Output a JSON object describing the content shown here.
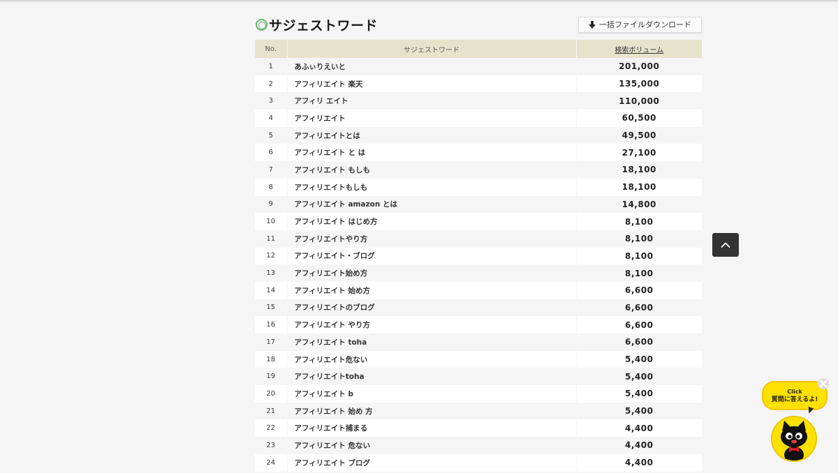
{
  "section": {
    "title": "サジェストワード",
    "download_label": "一括ファイルダウンロード"
  },
  "table": {
    "headers": {
      "no": "No.",
      "word": "サジェストワード",
      "volume": "検索ボリューム"
    },
    "rows": [
      {
        "no": "1",
        "word": "あふぃりえいと",
        "volume": "201,000"
      },
      {
        "no": "2",
        "word": "アフィリエイト 楽天",
        "volume": "135,000"
      },
      {
        "no": "3",
        "word": "アフィリ エイト",
        "volume": "110,000"
      },
      {
        "no": "4",
        "word": "アフィリエイト",
        "volume": "60,500"
      },
      {
        "no": "5",
        "word": "アフィリエイトとは",
        "volume": "49,500"
      },
      {
        "no": "6",
        "word": "アフィリエイト と は",
        "volume": "27,100"
      },
      {
        "no": "7",
        "word": "アフィリエイト もしも",
        "volume": "18,100"
      },
      {
        "no": "8",
        "word": "アフィリエイトもしも",
        "volume": "18,100"
      },
      {
        "no": "9",
        "word": "アフィリエイト amazon とは",
        "volume": "14,800"
      },
      {
        "no": "10",
        "word": "アフィリエイト はじめ方",
        "volume": "8,100"
      },
      {
        "no": "11",
        "word": "アフィリエイトやり方",
        "volume": "8,100"
      },
      {
        "no": "12",
        "word": "アフィリエイト・ブログ",
        "volume": "8,100"
      },
      {
        "no": "13",
        "word": "アフィリエイト始め方",
        "volume": "8,100"
      },
      {
        "no": "14",
        "word": "アフィリエイト 始め方",
        "volume": "6,600"
      },
      {
        "no": "15",
        "word": "アフィリエイトのブログ",
        "volume": "6,600"
      },
      {
        "no": "16",
        "word": "アフィリエイト やり方",
        "volume": "6,600"
      },
      {
        "no": "17",
        "word": "アフィリエイト toha",
        "volume": "6,600"
      },
      {
        "no": "18",
        "word": "アフィリエイト危ない",
        "volume": "5,400"
      },
      {
        "no": "19",
        "word": "アフィリエイトtoha",
        "volume": "5,400"
      },
      {
        "no": "20",
        "word": "アフィリエイト b",
        "volume": "5,400"
      },
      {
        "no": "21",
        "word": "アフィリエイト 始め 方",
        "volume": "5,400"
      },
      {
        "no": "22",
        "word": "アフィリエイト捕まる",
        "volume": "4,400"
      },
      {
        "no": "23",
        "word": "アフィリエイト 危ない",
        "volume": "4,400"
      },
      {
        "no": "24",
        "word": "アフィリエイト ブログ",
        "volume": "4,400"
      }
    ]
  },
  "chat_widget": {
    "click_label": "Click",
    "bubble_text": "質問に答えるよ!"
  },
  "colors": {
    "header_bg": "#e5e3cc",
    "accent_green": "#6cb66f",
    "widget_yellow": "#ffe100",
    "scroll_button": "#333333"
  },
  "icons": {
    "title": "double-circle-icon",
    "download": "arrow-down-icon",
    "scroll_top": "chevron-up-icon",
    "close": "close-icon"
  }
}
